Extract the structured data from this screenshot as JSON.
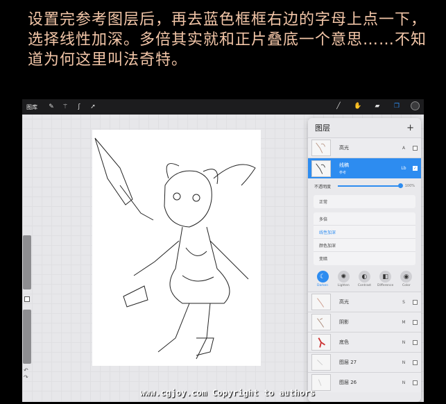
{
  "caption": "设置完参考图层后，再去蓝色框框右边的字母上点一下，选择线性加深。多倍其实就和正片叠底一个意思……不知道为何这里叫法奇特。",
  "toolbar": {
    "gallery_label": "图库",
    "left_icons": [
      "wrench-icon",
      "magic-wand-icon",
      "selection-icon",
      "transform-arrow-icon"
    ],
    "right_icons": [
      "brush-icon",
      "smudge-icon",
      "eraser-icon",
      "layers-icon",
      "color-picker-icon"
    ]
  },
  "layers_panel": {
    "title": "图层",
    "add_label": "+",
    "top_layers": [
      {
        "name": "高光",
        "mode": "A",
        "visible": false,
        "selected": false
      },
      {
        "name": "线稿",
        "sub": "参考",
        "mode": "Lb",
        "visible": true,
        "selected": true
      }
    ],
    "opacity": {
      "label": "不透明度",
      "value_text": "100%",
      "value": 1.0
    },
    "mode_current": "正常",
    "mode_options": [
      "多倍",
      "线性加深",
      "颜色加深",
      "变暗"
    ],
    "mode_active": "线性加深",
    "blend_buttons": [
      {
        "label": "Darken",
        "icon": "moon-icon",
        "active": true
      },
      {
        "label": "Lighten",
        "icon": "sun-icon",
        "active": false
      },
      {
        "label": "Contrast",
        "icon": "contrast-icon",
        "active": false
      },
      {
        "label": "Difference",
        "icon": "difference-icon",
        "active": false
      },
      {
        "label": "Color",
        "icon": "color-icon",
        "active": false
      }
    ],
    "bottom_layers": [
      {
        "name": "高光",
        "mode": "S",
        "visible": false
      },
      {
        "name": "阴影",
        "mode": "M",
        "visible": false
      },
      {
        "name": "底色",
        "mode": "N",
        "visible": false
      },
      {
        "name": "图层 27",
        "mode": "N",
        "visible": false
      },
      {
        "name": "图层 26",
        "mode": "N",
        "visible": false
      }
    ]
  },
  "colors": {
    "accent": "#2d8cf0",
    "toolbar": "#1c1c1e",
    "caption": "#f3c6a8"
  },
  "watermark": "www.cgjoy.com Copyright to authors"
}
